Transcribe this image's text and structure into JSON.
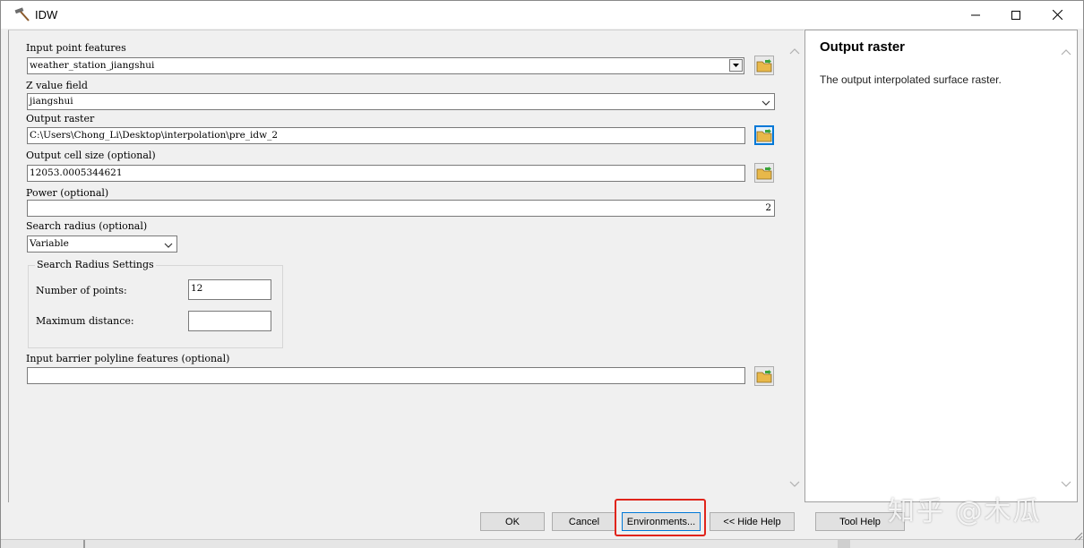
{
  "window": {
    "title": "IDW"
  },
  "form": {
    "input_point_features": {
      "label": "Input point features",
      "value": "weather_station_jiangshui"
    },
    "z_value_field": {
      "label": "Z value field",
      "value": "jiangshui"
    },
    "output_raster": {
      "label": "Output raster",
      "value": "C:\\Users\\Chong_Li\\Desktop\\interpolation\\pre_idw_2"
    },
    "output_cell_size": {
      "label": "Output cell size (optional)",
      "value": "12053.0005344621"
    },
    "power": {
      "label": "Power (optional)",
      "value": "2"
    },
    "search_radius": {
      "label": "Search radius (optional)",
      "value": "Variable"
    },
    "search_radius_settings": {
      "title": "Search Radius Settings",
      "number_of_points_label": "Number of points:",
      "number_of_points_value": "12",
      "maximum_distance_label": "Maximum distance:",
      "maximum_distance_value": ""
    },
    "input_barrier": {
      "label": "Input barrier polyline features (optional)",
      "value": ""
    }
  },
  "help": {
    "title": "Output raster",
    "description": "The output interpolated surface raster."
  },
  "buttons": {
    "ok": "OK",
    "cancel": "Cancel",
    "environments": "Environments...",
    "hide_help": "<< Hide Help",
    "tool_help": "Tool Help"
  },
  "watermark": "知乎 @木瓜",
  "colors": {
    "highlight": "#e0241b",
    "focus_blue": "#0078d7"
  }
}
